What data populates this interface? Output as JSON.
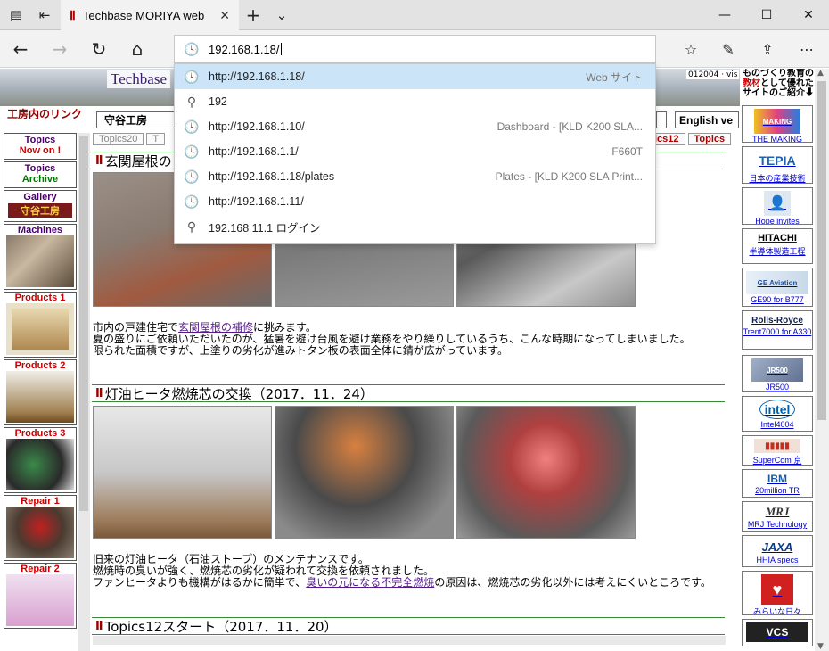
{
  "browser": {
    "tab_title": "Techbase MORIYA web",
    "tab_favicon": "Ⅱ",
    "address_value": "192.168.1.18/",
    "suggestions": [
      {
        "icon": "history-icon",
        "url": "http://192.168.1.18/",
        "right": "Web サイト",
        "selected": true
      },
      {
        "icon": "search-icon",
        "url": "192",
        "right": ""
      },
      {
        "icon": "history-icon",
        "url": "http://192.168.1.10/",
        "right": "Dashboard - [KLD K200 SLA..."
      },
      {
        "icon": "history-icon",
        "url": "http://192.168.1.1/",
        "right": "F660T"
      },
      {
        "icon": "history-icon",
        "url": "http://192.168.1.18/plates",
        "right": "Plates - [KLD K200 SLA Print..."
      },
      {
        "icon": "history-icon",
        "url": "http://192.168.1.11/",
        "right": ""
      },
      {
        "icon": "search-icon",
        "url": "192.168 11.1 ログイン",
        "right": ""
      }
    ]
  },
  "page": {
    "banner_title": "Techbase",
    "counter": "012004 · vis",
    "kobo_link": "工房内のリンク",
    "header_buttons": {
      "moriya": "守谷工房",
      "english": "English ve"
    },
    "topics_tabs": [
      "Topics20",
      "T",
      "ics12",
      "Topics"
    ],
    "left_nav": [
      {
        "l1": "Topics",
        "l2": "Now on !"
      },
      {
        "l1": "Topics",
        "l2": "Archive"
      },
      {
        "l1": "Gallery",
        "l2": "守谷工房"
      },
      {
        "l1": "Machines",
        "l2": ""
      },
      {
        "l1": "Products 1",
        "l2": ""
      },
      {
        "l1": "Products 2",
        "l2": ""
      },
      {
        "l1": "Products 3",
        "l2": ""
      },
      {
        "l1": "Repair 1",
        "l2": ""
      },
      {
        "l1": "Repair 2",
        "l2": ""
      }
    ],
    "sections": [
      {
        "mark": "Ⅱ",
        "title": "玄関屋根の",
        "lines": [
          {
            "pre": "市内の戸建住宅で",
            "link": "玄関屋根の補修",
            "post": "に挑みます。"
          },
          {
            "pre": "夏の盛りにご依頼いただいたのが、猛暑を避け台風を避け業務をやり繰りしているうち、こんな時期になってしまいました。",
            "link": "",
            "post": ""
          },
          {
            "pre": "限られた面積ですが、上塗りの劣化が進みトタン板の表面全体に錆が広がっています。",
            "link": "",
            "post": ""
          }
        ]
      },
      {
        "mark": "Ⅱ",
        "title": "灯油ヒータ燃焼芯の交換（2017．11．24）",
        "lines": [
          {
            "pre": "旧来の灯油ヒータ（石油ストーブ）のメンテナンスです。",
            "link": "",
            "post": ""
          },
          {
            "pre": "燃焼時の臭いが強く、燃焼芯の劣化が疑われて交換を依頼されました。",
            "link": "",
            "post": ""
          },
          {
            "pre": "ファンヒータよりも機構がはるかに簡単で、",
            "link": "臭いの元になる不完全燃焼",
            "post": "の原因は、燃焼芯の劣化以外には考えにくいところです。"
          }
        ]
      },
      {
        "mark": "Ⅱ",
        "title": "Topics12スタート（2017．11．20）",
        "lines": []
      }
    ],
    "right_header": {
      "l1": "ものづくり教育の",
      "l2": "教材",
      "l3": "として優れた",
      "l4": "サイトのご紹介⬇"
    },
    "right_links": [
      {
        "logo": "MAKING",
        "caption": "THE MAKING"
      },
      {
        "logo": "TEPIA",
        "caption": "日本の産業技術"
      },
      {
        "logo": "👤",
        "caption": "Hope invites"
      },
      {
        "logo": "HITACHI",
        "caption": "半導体製造工程"
      },
      {
        "logo": "GE Aviation",
        "caption": "GE90 for B777"
      },
      {
        "logo": "Rolls-Royce",
        "caption": "Trent7000 for A330"
      },
      {
        "logo": "JR500",
        "caption": "JR500"
      },
      {
        "logo": "intel",
        "caption": "Intel4004"
      },
      {
        "logo": "▮▮▮▮▮",
        "caption": "SuperCom 京"
      },
      {
        "logo": "IBM",
        "caption": "20million TR"
      },
      {
        "logo": "MRJ",
        "caption": "MRJ Technology"
      },
      {
        "logo": "JAXA",
        "caption": "HHIA specs"
      },
      {
        "logo": "♥",
        "caption": "みらいな日々"
      },
      {
        "logo": "VCS",
        "caption": ""
      }
    ]
  },
  "colors": {
    "accent": "#cce4f7",
    "link": "#551a8b",
    "section_rule": "#3a8a3a"
  }
}
